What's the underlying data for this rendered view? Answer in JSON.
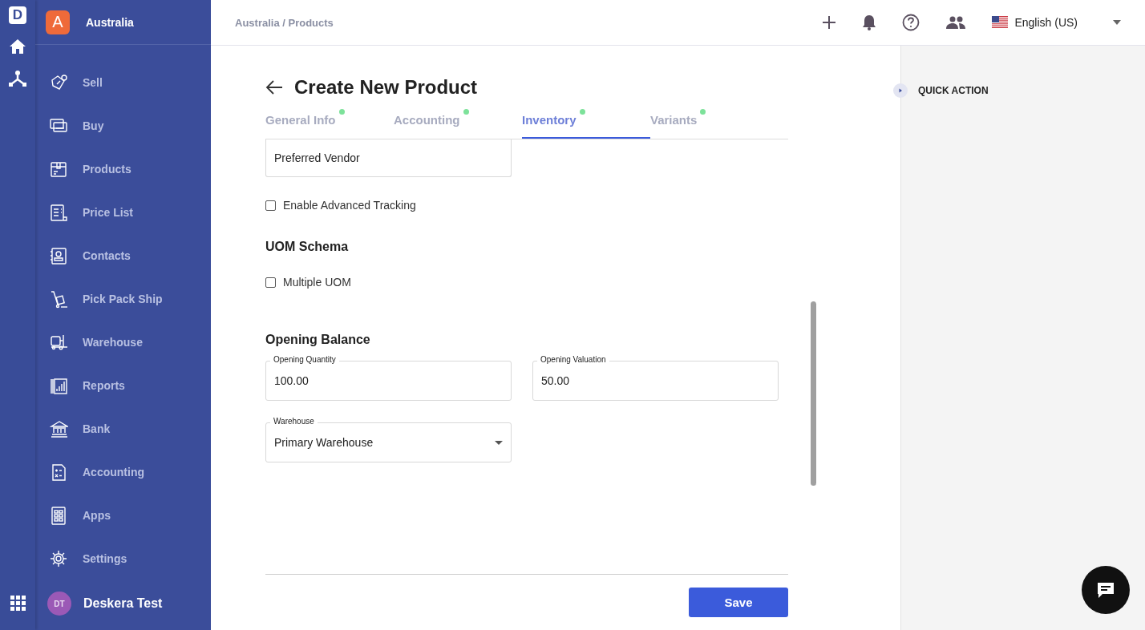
{
  "rail": {
    "logo": "D"
  },
  "org": {
    "initial": "A",
    "name": "Australia"
  },
  "sidebar": {
    "items": [
      {
        "label": "Sell"
      },
      {
        "label": "Buy"
      },
      {
        "label": "Products"
      },
      {
        "label": "Price List"
      },
      {
        "label": "Contacts"
      },
      {
        "label": "Pick Pack Ship"
      },
      {
        "label": "Warehouse"
      },
      {
        "label": "Reports"
      },
      {
        "label": "Bank"
      },
      {
        "label": "Accounting"
      },
      {
        "label": "Apps"
      },
      {
        "label": "Settings"
      }
    ],
    "user": {
      "initials": "DT",
      "name": "Deskera Test"
    }
  },
  "header": {
    "breadcrumb": "Australia / Products",
    "language": "English (US)"
  },
  "page": {
    "title": "Create New Product",
    "tabs": [
      {
        "label": "General Info",
        "selected": false,
        "complete": true
      },
      {
        "label": "Accounting",
        "selected": false,
        "complete": true
      },
      {
        "label": "Inventory",
        "selected": true,
        "complete": true
      },
      {
        "label": "Variants",
        "selected": false,
        "complete": true
      }
    ],
    "preferred_vendor": {
      "placeholder": "Preferred Vendor"
    },
    "advanced_tracking": {
      "label": "Enable Advanced Tracking",
      "checked": false
    },
    "uom_heading": "UOM Schema",
    "multiple_uom": {
      "label": "Multiple UOM",
      "checked": false
    },
    "opening_heading": "Opening Balance",
    "fields": [
      {
        "label": "Opening Quantity",
        "value": "100.00"
      },
      {
        "label": "Opening Valuation",
        "value": "50.00"
      }
    ],
    "warehouse": {
      "label": "Warehouse",
      "value": "Primary Warehouse"
    },
    "save": "Save"
  },
  "quick_action": {
    "title": "QUICK ACTION"
  }
}
